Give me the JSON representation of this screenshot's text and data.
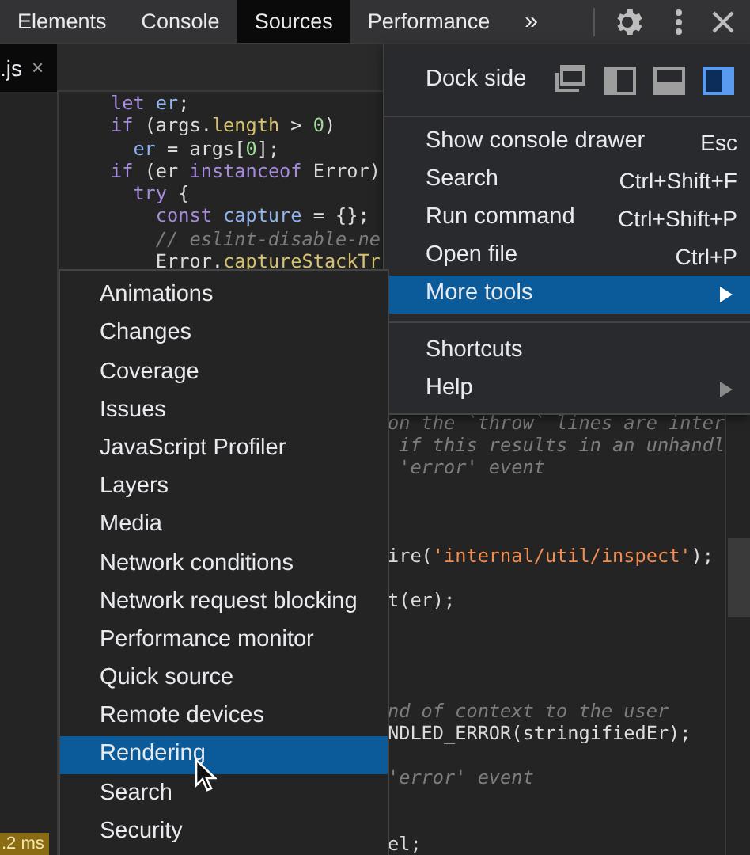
{
  "tabs": [
    {
      "label": "Elements",
      "selected": false
    },
    {
      "label": "Console",
      "selected": false
    },
    {
      "label": "Sources",
      "selected": true
    },
    {
      "label": "Performance",
      "selected": false
    }
  ],
  "overflow_button": "»",
  "file_tab": {
    "label": ".js",
    "close": "×",
    "selected": true
  },
  "code_top": [
    {
      "segments": [
        {
          "text": "let",
          "kind": "keyword"
        },
        {
          "text": " er",
          "kind": "variable"
        },
        {
          "text": ";",
          "kind": "plain"
        }
      ]
    },
    {
      "segments": [
        {
          "text": "if",
          "kind": "keyword"
        },
        {
          "text": " (args.",
          "kind": "plain"
        },
        {
          "text": "length",
          "kind": "property"
        },
        {
          "text": " > ",
          "kind": "plain"
        },
        {
          "text": "0",
          "kind": "number"
        },
        {
          "text": ")",
          "kind": "plain"
        }
      ]
    },
    {
      "segments": [
        {
          "text": "  er",
          "kind": "variable"
        },
        {
          "text": " = args[",
          "kind": "plain"
        },
        {
          "text": "0",
          "kind": "number"
        },
        {
          "text": "];",
          "kind": "plain"
        }
      ]
    },
    {
      "segments": [
        {
          "text": "if",
          "kind": "keyword"
        },
        {
          "text": " (er ",
          "kind": "plain"
        },
        {
          "text": "instanceof",
          "kind": "keyword"
        },
        {
          "text": " Error)",
          "kind": "plain"
        }
      ]
    },
    {
      "segments": [
        {
          "text": "  try",
          "kind": "keyword"
        },
        {
          "text": " {",
          "kind": "plain"
        }
      ]
    },
    {
      "segments": [
        {
          "text": "    const",
          "kind": "keyword"
        },
        {
          "text": " capture",
          "kind": "variable"
        },
        {
          "text": " = {};",
          "kind": "plain"
        }
      ]
    },
    {
      "segments": [
        {
          "text": "    // eslint-disable-ne",
          "kind": "comment"
        }
      ]
    },
    {
      "segments": [
        {
          "text": "    Error.",
          "kind": "plain"
        },
        {
          "text": "captureStackTr",
          "kind": "property"
        }
      ]
    }
  ],
  "code_right": [
    {
      "kind": "code",
      "segments": [
        {
          "text": "on the `throw` lines are inter",
          "kind": "comment"
        }
      ]
    },
    {
      "kind": "code",
      "segments": [
        {
          "text": " if this results in an unhandl",
          "kind": "comment"
        }
      ]
    },
    {
      "kind": "code",
      "segments": [
        {
          "text": " 'error' event",
          "kind": "comment"
        }
      ]
    },
    {
      "kind": "blank"
    },
    {
      "kind": "blank"
    },
    {
      "kind": "blank"
    },
    {
      "kind": "code",
      "segments": [
        {
          "text": "ire(",
          "kind": "plain"
        },
        {
          "text": "'internal/util/inspect'",
          "kind": "string"
        },
        {
          "text": ");",
          "kind": "plain"
        }
      ]
    },
    {
      "kind": "blank"
    },
    {
      "kind": "code",
      "segments": [
        {
          "text": "t(er);",
          "kind": "plain"
        }
      ]
    },
    {
      "kind": "blank"
    },
    {
      "kind": "blank"
    },
    {
      "kind": "blank"
    },
    {
      "kind": "blank"
    },
    {
      "kind": "code",
      "segments": [
        {
          "text": "nd of context to the user",
          "kind": "comment"
        }
      ]
    },
    {
      "kind": "code",
      "segments": [
        {
          "text": "NDLED_ERROR(stringifiedEr);",
          "kind": "plain"
        }
      ]
    },
    {
      "kind": "blank"
    },
    {
      "kind": "code",
      "segments": [
        {
          "text": "'error' event",
          "kind": "comment"
        }
      ]
    },
    {
      "kind": "blank"
    },
    {
      "kind": "blank"
    },
    {
      "kind": "code",
      "segments": [
        {
          "text": "el;",
          "kind": "plain"
        }
      ]
    }
  ],
  "timing_badge": ".2 ms",
  "main_menu": {
    "dock_side": {
      "label": "Dock side",
      "options": [
        {
          "kind": "undock",
          "selected": false
        },
        {
          "kind": "left",
          "selected": false
        },
        {
          "kind": "bottom",
          "selected": false
        },
        {
          "kind": "right",
          "selected": true
        }
      ]
    },
    "items": [
      {
        "kind": "divider"
      },
      {
        "kind": "item",
        "label": "Show console drawer",
        "shortcut": "Esc",
        "selected": false,
        "submenu": false
      },
      {
        "kind": "item",
        "label": "Search",
        "shortcut": "Ctrl+Shift+F",
        "selected": false,
        "submenu": false
      },
      {
        "kind": "item",
        "label": "Run command",
        "shortcut": "Ctrl+Shift+P",
        "selected": false,
        "submenu": false
      },
      {
        "kind": "item",
        "label": "Open file",
        "shortcut": "Ctrl+P",
        "selected": false,
        "submenu": false
      },
      {
        "kind": "item",
        "label": "More tools",
        "selected": true,
        "submenu": true
      },
      {
        "kind": "divider"
      },
      {
        "kind": "item",
        "label": "Shortcuts",
        "selected": false,
        "submenu": false
      },
      {
        "kind": "item",
        "label": "Help",
        "selected": false,
        "submenu": true
      }
    ]
  },
  "more_tools_menu": [
    {
      "label": "Animations",
      "selected": false
    },
    {
      "label": "Changes",
      "selected": false
    },
    {
      "label": "Coverage",
      "selected": false
    },
    {
      "label": "Issues",
      "selected": false
    },
    {
      "label": "JavaScript Profiler",
      "selected": false
    },
    {
      "label": "Layers",
      "selected": false
    },
    {
      "label": "Media",
      "selected": false
    },
    {
      "label": "Network conditions",
      "selected": false
    },
    {
      "label": "Network request blocking",
      "selected": false
    },
    {
      "label": "Performance monitor",
      "selected": false
    },
    {
      "label": "Quick source",
      "selected": false
    },
    {
      "label": "Remote devices",
      "selected": false
    },
    {
      "label": "Rendering",
      "selected": true
    },
    {
      "label": "Search",
      "selected": false
    },
    {
      "label": "Security",
      "selected": false
    }
  ]
}
